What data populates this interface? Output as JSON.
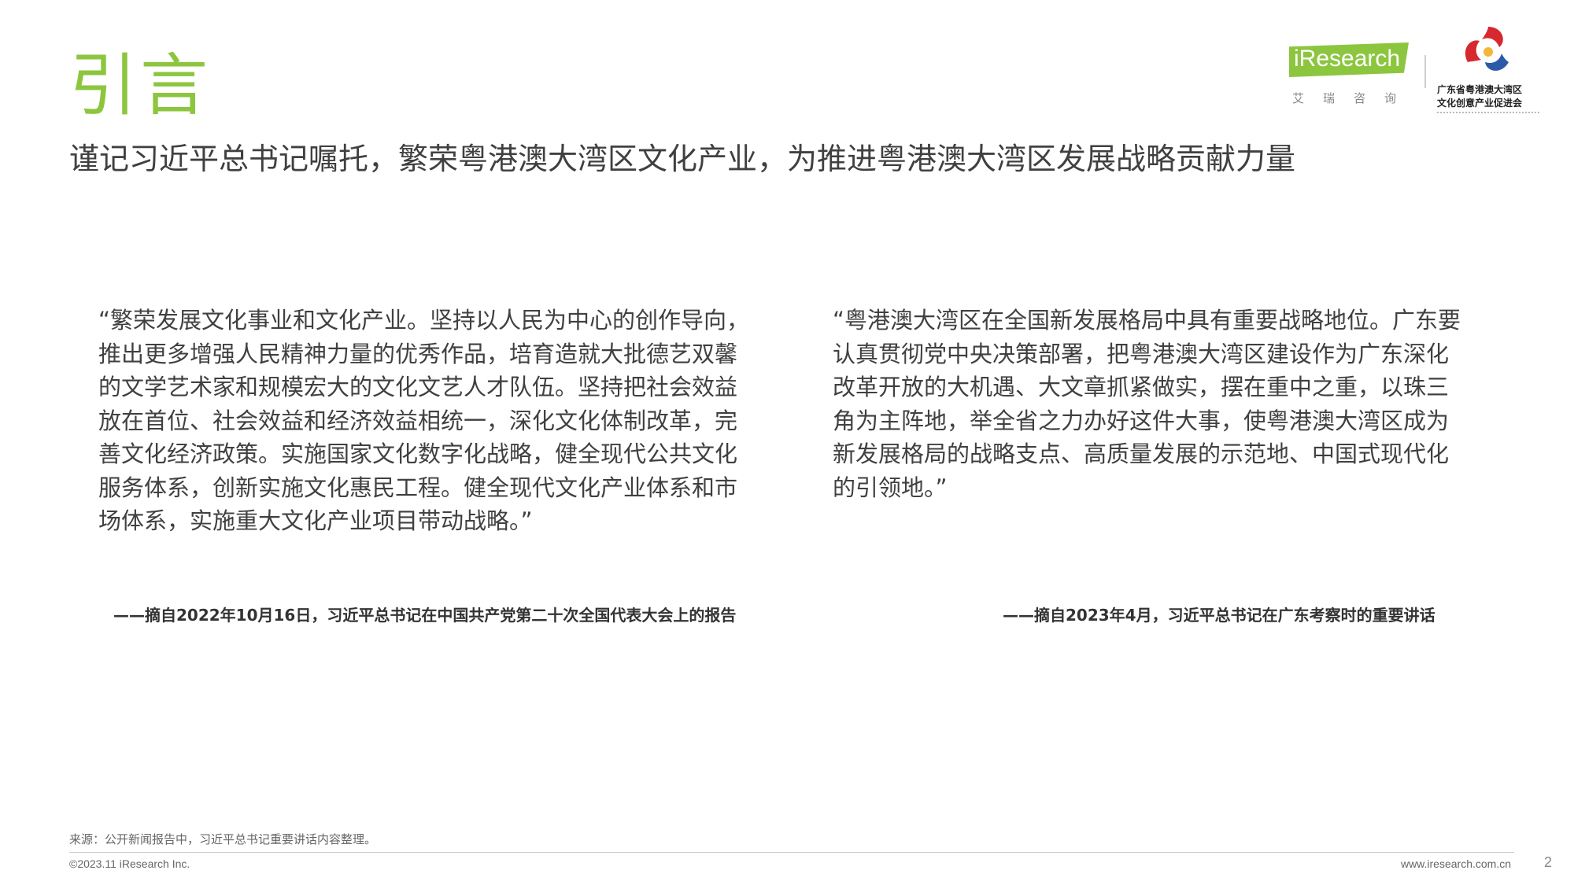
{
  "page": {
    "title": "引言",
    "subtitle": "谨记习近平总书记嘱托，繁荣粤港澳大湾区文化产业，为推进粤港澳大湾区发展战略贡献力量"
  },
  "header": {
    "ireseach_logo_text": "iResearch",
    "ireseach_logo_cn": "艾瑞咨询",
    "association_name_line1": "广东省粤港澳大湾区",
    "association_name_line2": "文化创意产业促进会",
    "colors": {
      "accent": "#8cc63f",
      "logo_red": "#d7282f",
      "logo_blue": "#2b5ba8"
    }
  },
  "quotes": [
    {
      "text": "“繁荣发展文化事业和文化产业。坚持以人民为中心的创作导向，推出更多增强人民精神力量的优秀作品，培育造就大批德艺双馨的文学艺术家和规模宏大的文化文艺人才队伍。坚持把社会效益放在首位、社会效益和经济效益相统一，深化文化体制改革，完善文化经济政策。实施国家文化数字化战略，健全现代公共文化服务体系，创新实施文化惠民工程。健全现代文化产业体系和市场体系，实施重大文化产业项目带动战略。”",
      "attribution": "——摘自2022年10月16日，习近平总书记在中国共产党第二十次全国代表大会上的报告"
    },
    {
      "text": "“粤港澳大湾区在全国新发展格局中具有重要战略地位。广东要认真贯彻党中央决策部署，把粤港澳大湾区建设作为广东深化改革开放的大机遇、大文章抓紧做实，摆在重中之重，以珠三角为主阵地，举全省之力办好这件大事，使粤港澳大湾区成为新发展格局的战略支点、高质量发展的示范地、中国式现代化的引领地。”",
      "attribution": "——摘自2023年4月，习近平总书记在广东考察时的重要讲话"
    }
  ],
  "footer": {
    "source": "来源：公开新闻报告中，习近平总书记重要讲话内容整理。",
    "copyright": "©2023.11 iResearch Inc.",
    "website": "www.iresearch.com.cn",
    "page_number": "2"
  }
}
